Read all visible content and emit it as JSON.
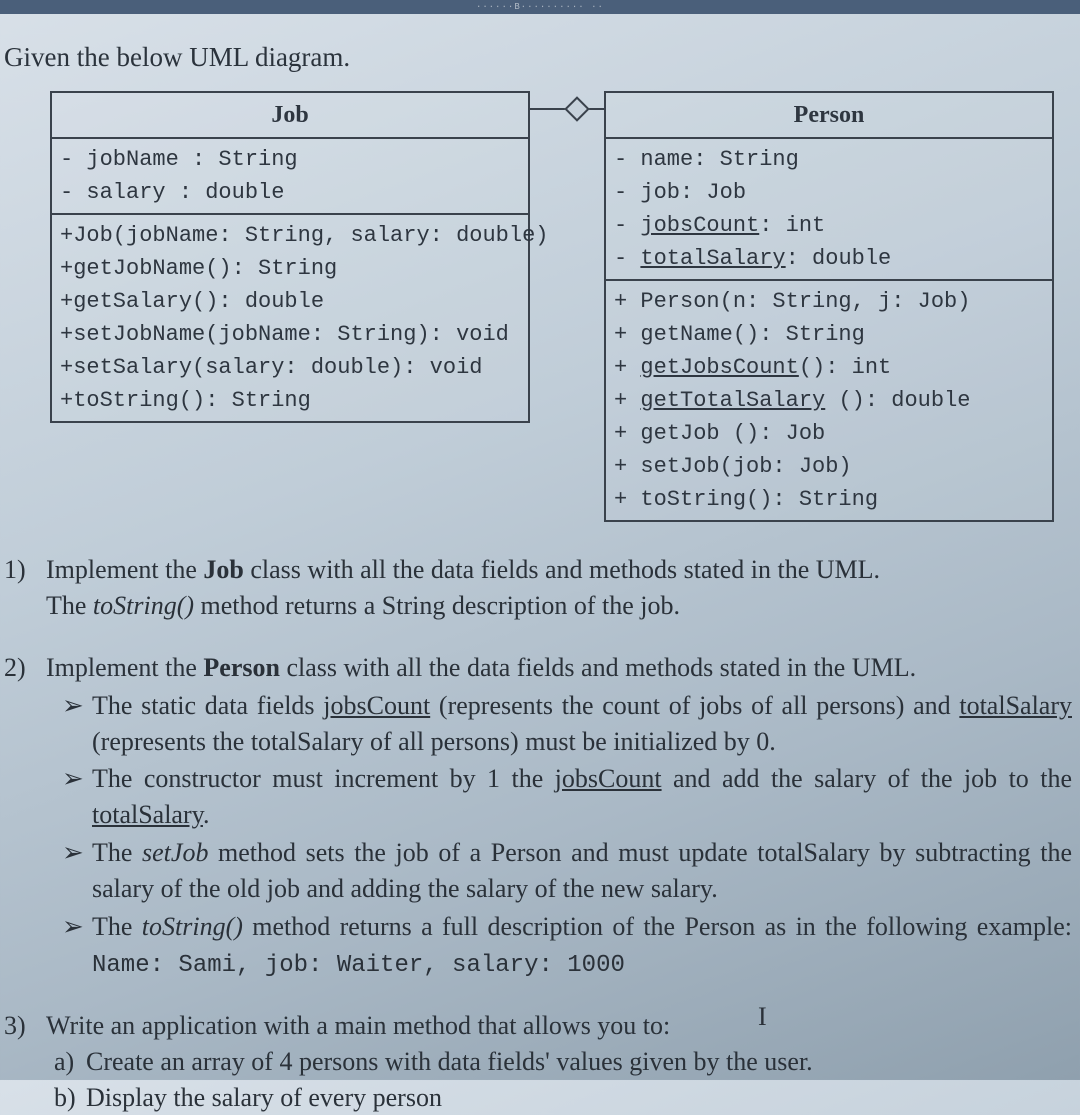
{
  "topbar_text": "··∙∙∙∙B∙∙∙∙∙∙∙∙∙∙ ∙∙",
  "heading": "Given the below UML diagram.",
  "uml": {
    "job": {
      "title": "Job",
      "attrs": [
        "- jobName : String",
        "- salary : double"
      ],
      "methods": [
        "+Job(jobName: String, salary: double)",
        "+getJobName(): String",
        "+getSalary(): double",
        "+setJobName(jobName: String): void",
        "+setSalary(salary: double): void",
        "+toString(): String"
      ]
    },
    "person": {
      "title": "Person",
      "attrs": [
        {
          "pre": "- name: String",
          "u": "",
          "post": ""
        },
        {
          "pre": "- job: Job",
          "u": "",
          "post": ""
        },
        {
          "pre": "- ",
          "u": "jobsCount",
          "post": ": int"
        },
        {
          "pre": "- ",
          "u": "totalSalary",
          "post": ": double"
        }
      ],
      "methods": [
        {
          "pre": "+ Person(n: String, j: Job)",
          "u": "",
          "post": ""
        },
        {
          "pre": "+ getName(): String",
          "u": "",
          "post": ""
        },
        {
          "pre": "+ ",
          "u": "getJobsCount",
          "post": "(): int"
        },
        {
          "pre": "+ ",
          "u": "getTotalSalary",
          "post": " (): double"
        },
        {
          "pre": "+ getJob (): Job",
          "u": "",
          "post": ""
        },
        {
          "pre": "+ setJob(job: Job)",
          "u": "",
          "post": ""
        },
        {
          "pre": "+ toString(): String",
          "u": "",
          "post": ""
        }
      ]
    }
  },
  "q1": {
    "num": "1)",
    "line1a": "Implement the ",
    "line1b": "Job",
    "line1c": " class with all the data fields and methods stated in the UML.",
    "line2a": "The ",
    "line2b": "toString()",
    "line2c": " method returns a String description of the job."
  },
  "q2": {
    "num": "2)",
    "intro_a": "Implement the ",
    "intro_b": "Person",
    "intro_c": " class with all the data fields and methods stated in the UML.",
    "b1_a": "The static data fields ",
    "b1_u1": "jobsCount",
    "b1_b": " (represents the count of jobs of all persons) and ",
    "b1_u2": "totalSalary",
    "b1_c": " (represents the totalSalary of all persons) must be initialized by 0.",
    "b2_a": "The constructor must increment by 1 the ",
    "b2_u1": "jobsCount",
    "b2_b": " and add the salary of the job to the ",
    "b2_u2": "totalSalary",
    "b2_c": ".",
    "b3_a": "The ",
    "b3_i": "setJob",
    "b3_b": " method sets the job of a Person and must update totalSalary by subtracting the salary of the old job and adding the salary of the new salary.",
    "b4_a": "The ",
    "b4_i": "toString()",
    "b4_b": " method returns a full description of the Person as in the following example: ",
    "b4_code": "Name: Sami, job: Waiter, salary: 1000"
  },
  "q3": {
    "num": "3)",
    "intro": "Write an application with a main method that allows you to:",
    "a_label": "a)",
    "a_text": "Create an array of 4 persons with data fields' values given by the user.",
    "b_label": "b)",
    "b_text": "Display the salary of every person"
  },
  "arrow": "➢",
  "cursor_glyph": "I"
}
